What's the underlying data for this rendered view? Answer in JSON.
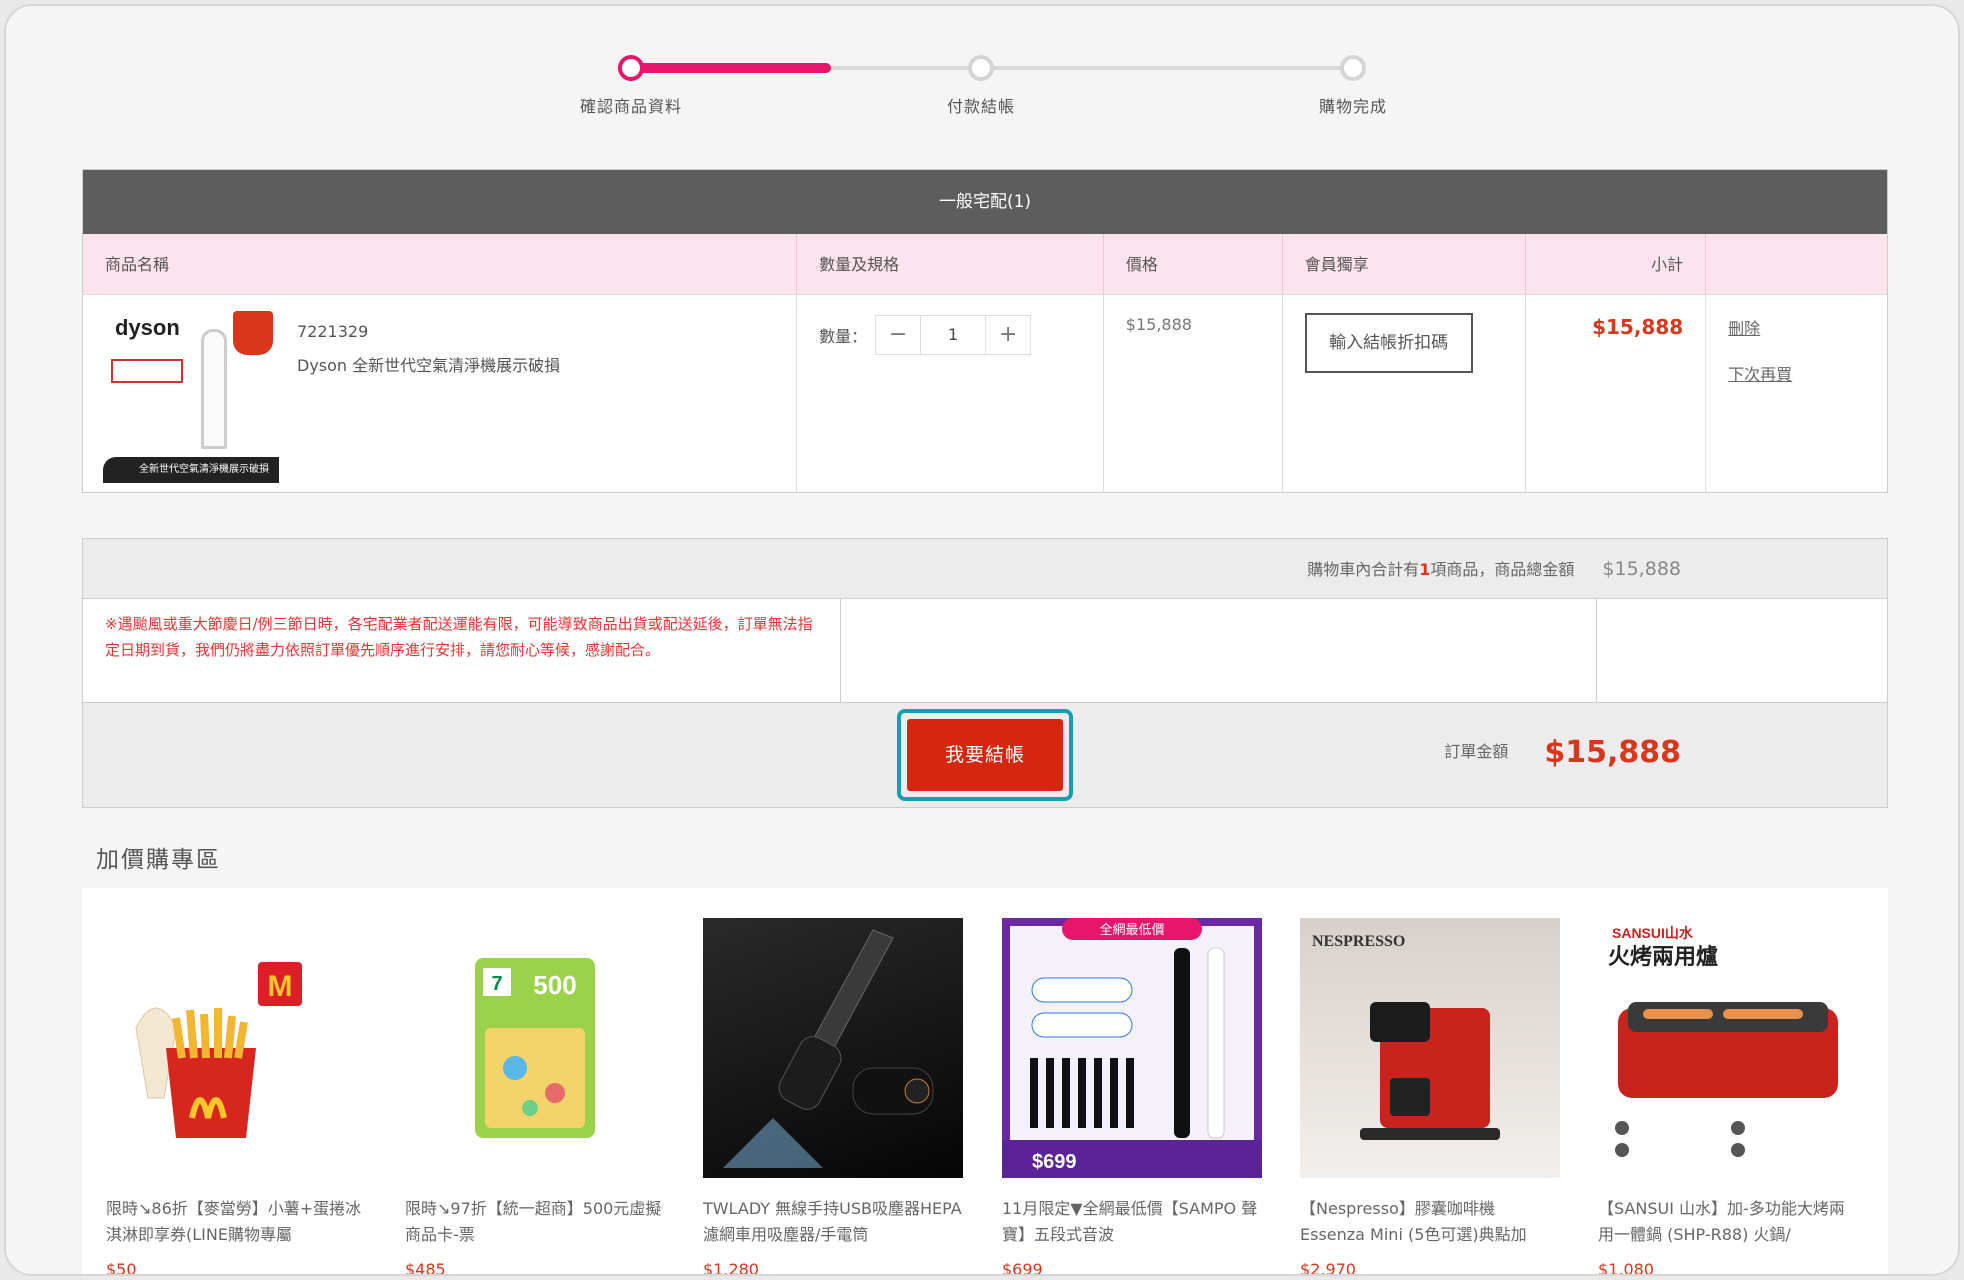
{
  "steps": [
    {
      "label": "確認商品資料",
      "active": true
    },
    {
      "label": "付款結帳",
      "active": false
    },
    {
      "label": "購物完成",
      "active": false
    }
  ],
  "cart": {
    "section_title": "一般宅配(1)",
    "columns": [
      "商品名稱",
      "數量及規格",
      "價格",
      "會員獨享",
      "小計",
      ""
    ],
    "item": {
      "brand_logo": "dyson",
      "product_code": "7221329",
      "product_name": "Dyson 全新世代空氣清淨機展示破損",
      "image_caption": "全新世代空氣清淨機展示破損",
      "qty_label": "數量：",
      "qty": "1",
      "minus": "−",
      "plus": "+",
      "price": "$15,888",
      "coupon_button": "輸入結帳折扣碼",
      "subtotal": "$15,888",
      "delete_link": "刪除",
      "later_link": "下次再買"
    }
  },
  "summary": {
    "count_prefix": "購物車內合計有",
    "count": "1",
    "count_suffix": "項商品，商品總金額",
    "total": "$15,888",
    "notice": "※遇颱風或重大節慶日/例三節日時，各宅配業者配送運能有限，可能導致商品出貨或配送延後，訂單無法指定日期到貨，我們仍將盡力依照訂單優先順序進行安排，請您耐心等候，感謝配合。",
    "checkout_button": "我要結帳",
    "order_total_label": "訂單金額",
    "order_total": "$15,888"
  },
  "addon": {
    "title": "加價購專區",
    "items": [
      {
        "name": "限時↘86折【麥當勞】小薯+蛋捲冰淇淋即享券(LINE購物專屬",
        "price": "$50"
      },
      {
        "name": "限時↘97折【統一超商】500元虛擬商品卡-票",
        "price": "$485"
      },
      {
        "name": "TWLADY 無線手持USB吸塵器HEPA濾網車用吸塵器/手電筒",
        "price": "$1,280"
      },
      {
        "name": "11月限定▼全網最低價【SAMPO 聲寶】五段式音波",
        "price": "$699"
      },
      {
        "name": "【Nespresso】膠囊咖啡機 Essenza Mini (5色可選)典點加",
        "price": "$2,970"
      },
      {
        "name": "【SANSUI 山水】加-多功能大烤兩用一體鍋 (SHP-R88) 火鍋/",
        "price": "$1,080"
      }
    ],
    "image_texts": {
      "gift_value": "500",
      "toothbrush_banner": "全網最低價",
      "toothbrush_price": "$699",
      "nespresso_brand": "NESPRESSO",
      "sansui_brand": "SANSUI山水",
      "sansui_title": "火烤兩用爐"
    }
  },
  "colors": {
    "accent_pink": "#e8166a",
    "price_red": "#d9361c",
    "checkout_red": "#d7260f",
    "focus_teal": "#14a0b4"
  }
}
